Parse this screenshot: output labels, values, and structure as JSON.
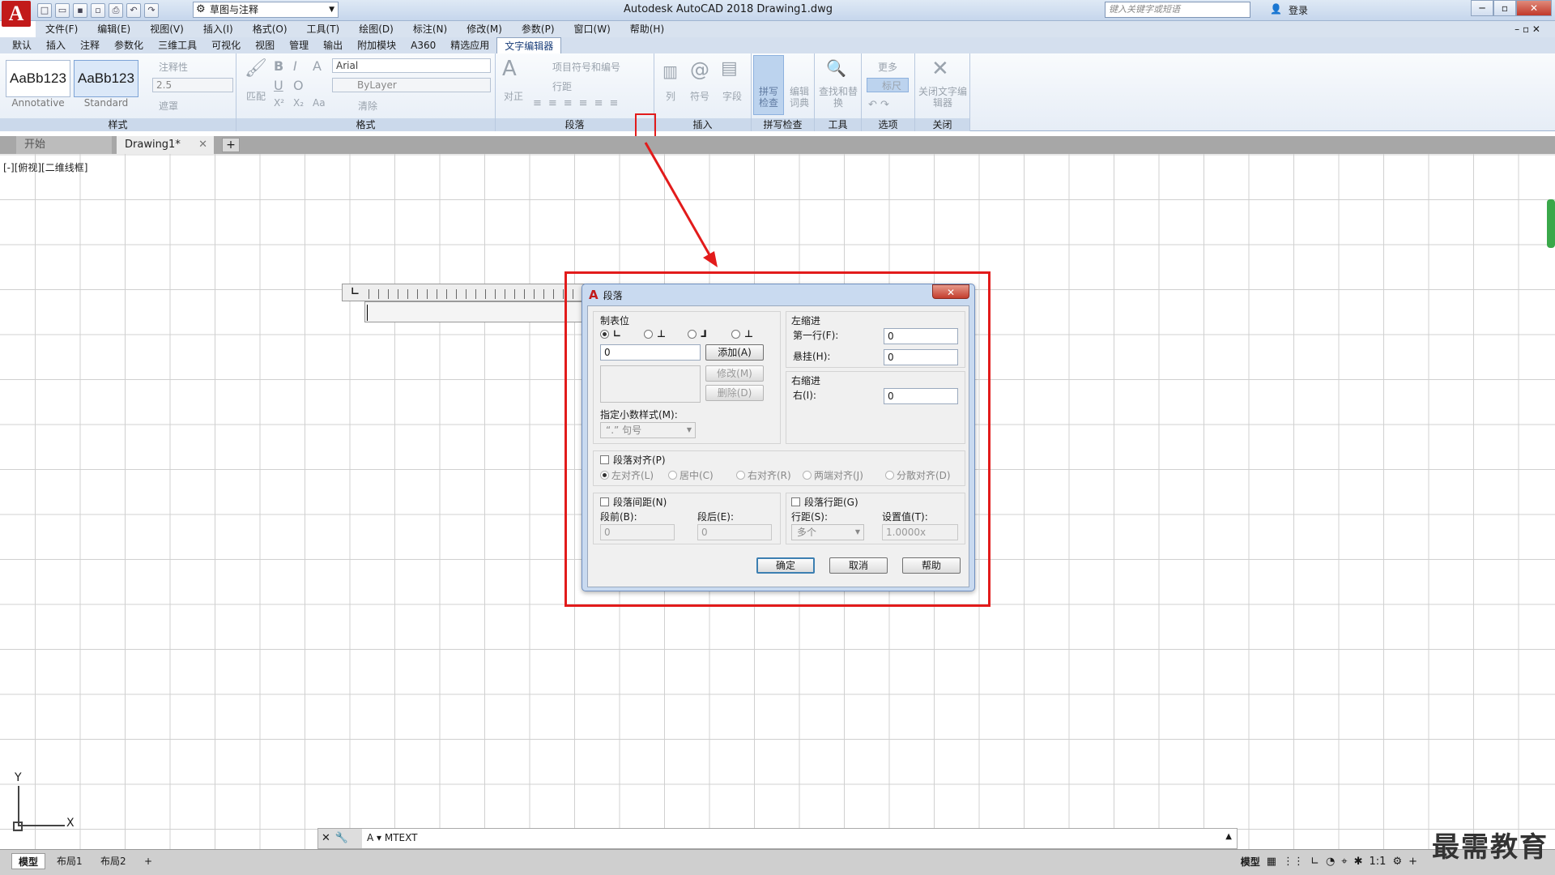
{
  "app": {
    "logo": "A",
    "title": "Autodesk AutoCAD 2018    Drawing1.dwg",
    "workspace": "草图与注释",
    "search_placeholder": "键入关键字或短语",
    "login": "登录"
  },
  "menu": [
    "文件(F)",
    "编辑(E)",
    "视图(V)",
    "插入(I)",
    "格式(O)",
    "工具(T)",
    "绘图(D)",
    "标注(N)",
    "修改(M)",
    "参数(P)",
    "窗口(W)",
    "帮助(H)"
  ],
  "ribbon_tabs": [
    "默认",
    "插入",
    "注释",
    "参数化",
    "三维工具",
    "可视化",
    "视图",
    "管理",
    "输出",
    "附加模块",
    "A360",
    "精选应用",
    "文字编辑器"
  ],
  "ribbon": {
    "style_panel": {
      "title": "样式",
      "samples": [
        {
          "text": "AaBb123",
          "label": "Annotative"
        },
        {
          "text": "AaBb123",
          "label": "Standard"
        }
      ],
      "annotative": "注释性",
      "height": "2.5",
      "mask": "遮罩"
    },
    "format_panel": {
      "title": "格式",
      "match": "匹配",
      "font": "Arial",
      "color": "ByLayer",
      "clear": "清除"
    },
    "paragraph_panel": {
      "title": "段落",
      "justify": "对正",
      "bullets": "项目符号和编号",
      "line_spacing": "行距"
    },
    "insert_panel": {
      "title": "插入",
      "columns": "列",
      "symbol": "符号",
      "field": "字段"
    },
    "spell_panel": {
      "title": "拼写检查",
      "spell_check": "拼写检查",
      "edit_dict": "编辑词典"
    },
    "tools_panel": {
      "title": "工具",
      "find_replace": "查找和替换"
    },
    "options_panel": {
      "title": "选项",
      "more": "更多",
      "ruler": "标尺"
    },
    "close_panel": {
      "title": "关闭",
      "close_editor": "关闭文字编辑器"
    }
  },
  "doc_tabs": {
    "start": "开始",
    "active": "Drawing1*"
  },
  "viewport_label": "[-][俯视][二维线框]",
  "ucs": {
    "x": "X",
    "y": "Y"
  },
  "command_line": "MTEXT",
  "layout_tabs": [
    "模型",
    "布局1",
    "布局2"
  ],
  "status": {
    "model": "模型",
    "scale": "1:1"
  },
  "watermark": "最需教育",
  "dialog": {
    "title": "段落",
    "tab_stops": {
      "title": "制表位",
      "value": "0",
      "add": "添加(A)",
      "modify": "修改(M)",
      "delete": "删除(D)",
      "decimal_label": "指定小数样式(M):",
      "decimal_value": "“.” 句号"
    },
    "left_indent": {
      "title": "左缩进",
      "first_line": "第一行(F):",
      "first_line_value": "0",
      "hanging": "悬挂(H):",
      "hanging_value": "0"
    },
    "right_indent": {
      "title": "右缩进",
      "right": "右(I):",
      "right_value": "0"
    },
    "alignment": {
      "title": "段落对齐(P)",
      "options": [
        "左对齐(L)",
        "居中(C)",
        "右对齐(R)",
        "两端对齐(J)",
        "分散对齐(D)"
      ]
    },
    "spacing": {
      "title": "段落间距(N)",
      "before": "段前(B):",
      "before_value": "0",
      "after": "段后(E):",
      "after_value": "0"
    },
    "line_spacing": {
      "title": "段落行距(G)",
      "spacing": "行距(S):",
      "spacing_value": "多个",
      "at": "设置值(T):",
      "at_value": "1.0000x"
    },
    "ok": "确定",
    "cancel": "取消",
    "help": "帮助"
  }
}
